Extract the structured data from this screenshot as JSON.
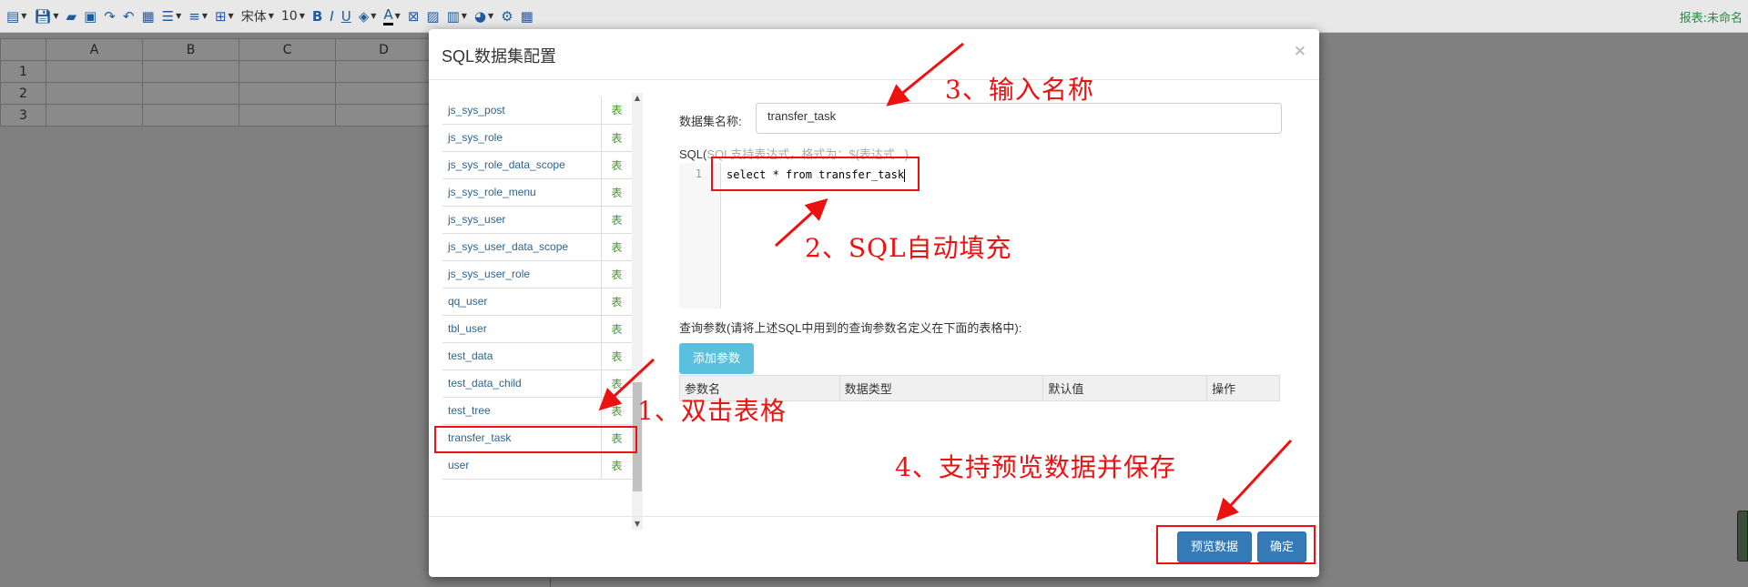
{
  "toolbar": {
    "font_name": "宋体",
    "font_size": "10",
    "right_text": "报表:未命名"
  },
  "sheet": {
    "columns": [
      "A",
      "B",
      "C",
      "D"
    ],
    "rows": [
      "1",
      "2",
      "3"
    ]
  },
  "modal": {
    "title": "SQL数据集配置",
    "close_label": "×"
  },
  "table_list": {
    "items": [
      {
        "name": "js_sys_post",
        "type": "表"
      },
      {
        "name": "js_sys_role",
        "type": "表"
      },
      {
        "name": "js_sys_role_data_scope",
        "type": "表"
      },
      {
        "name": "js_sys_role_menu",
        "type": "表"
      },
      {
        "name": "js_sys_user",
        "type": "表"
      },
      {
        "name": "js_sys_user_data_scope",
        "type": "表"
      },
      {
        "name": "js_sys_user_role",
        "type": "表"
      },
      {
        "name": "qq_user",
        "type": "表"
      },
      {
        "name": "tbl_user",
        "type": "表"
      },
      {
        "name": "test_data",
        "type": "表"
      },
      {
        "name": "test_data_child",
        "type": "表"
      },
      {
        "name": "test_tree",
        "type": "表"
      },
      {
        "name": "transfer_task",
        "type": "表"
      },
      {
        "name": "user",
        "type": "表"
      }
    ]
  },
  "form": {
    "dataset_name_label": "数据集名称:",
    "dataset_name_value": "transfer_task",
    "sql_label": "SQL(",
    "sql_hint": "SQL支持表达式，格式为：${表达式...}",
    "line_number": "1",
    "sql_code": "select * from transfer_task",
    "params_label": "查询参数(请将上述SQL中用到的查询参数名定义在下面的表格中):",
    "add_param_button": "添加参数",
    "param_columns": [
      "参数名",
      "数据类型",
      "默认值",
      "操作"
    ]
  },
  "footer": {
    "preview_button": "预览数据",
    "confirm_button": "确定"
  },
  "annotations": {
    "step1": "1、双击表格",
    "step2": "2、SQL自动填充",
    "step3": "3、输入名称",
    "step4": "4、支持预览数据并保存"
  },
  "colors": {
    "annotation": "#ee1111",
    "primary": "#337ab7",
    "info": "#5bc0de",
    "table_type": "#3c9a1a"
  }
}
